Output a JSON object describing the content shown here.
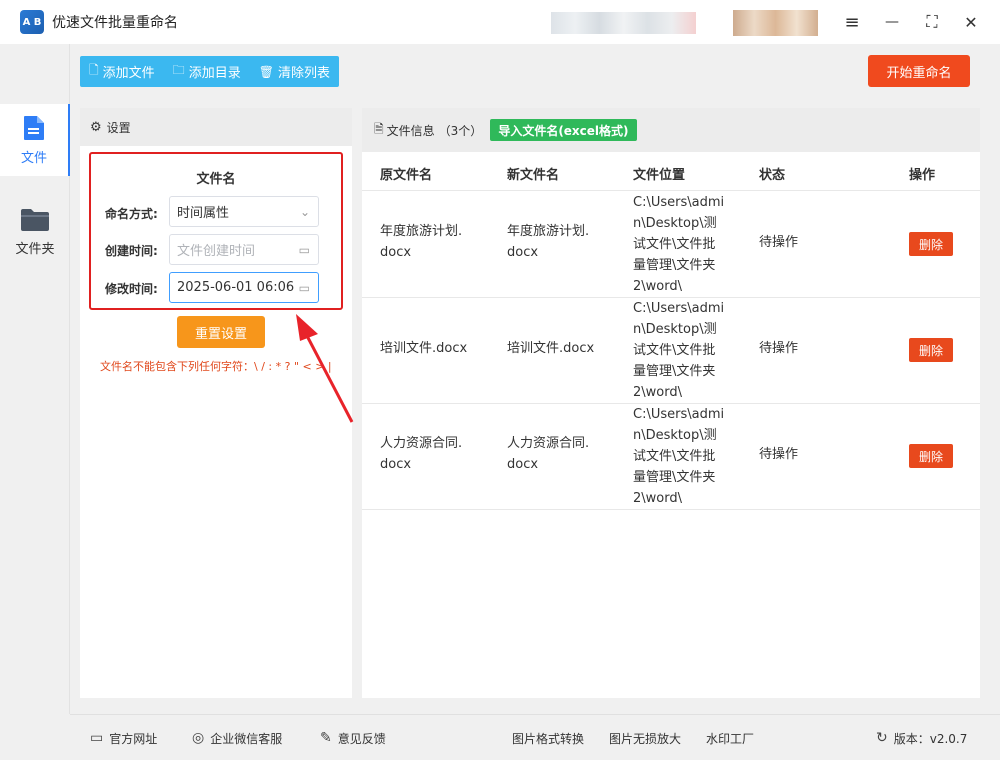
{
  "app": {
    "logo_text": "A B",
    "title": "优速文件批量重命名"
  },
  "window": {
    "menu_icon": "≡",
    "minimize_icon": "—",
    "maximize_icon": "⛶",
    "close_icon": "✕"
  },
  "rail": {
    "file_label": "文件",
    "folder_label": "文件夹"
  },
  "toolbar": {
    "add_file": "添加文件",
    "add_dir": "添加目录",
    "clear_list": "清除列表",
    "start": "开始重命名"
  },
  "settings": {
    "header": "设置",
    "group_title": "文件名",
    "naming_label": "命名方式:",
    "naming_value": "时间属性",
    "created_label": "创建时间:",
    "created_placeholder": "文件创建时间",
    "modified_label": "修改时间:",
    "modified_value": "2025-06-01 06:06",
    "reset": "重置设置",
    "warning": "文件名不能包含下列任何字符：\\ / : * ? \" < > |"
  },
  "files": {
    "header": "文件信息",
    "count": "（3个）",
    "import_btn": "导入文件名(excel格式)",
    "columns": [
      "原文件名",
      "新文件名",
      "文件位置",
      "状态",
      "操作"
    ],
    "rows": [
      {
        "original": "年度旅游计划.\ndocx",
        "new": "年度旅游计划.\ndocx",
        "location": "C:\\Users\\admi\nn\\Desktop\\测\n试文件\\文件批\n量管理\\文件夹\n2\\word\\",
        "status": "待操作",
        "action": "删除"
      },
      {
        "original": "培训文件.docx",
        "new": "培训文件.docx",
        "location": "C:\\Users\\admi\nn\\Desktop\\测\n试文件\\文件批\n量管理\\文件夹\n2\\word\\",
        "status": "待操作",
        "action": "删除"
      },
      {
        "original": "人力资源合同.\ndocx",
        "new": "人力资源合同.\ndocx",
        "location": "C:\\Users\\admi\nn\\Desktop\\测\n试文件\\文件批\n量管理\\文件夹\n2\\word\\",
        "status": "待操作",
        "action": "删除"
      }
    ]
  },
  "footer": {
    "website": "官方网址",
    "wechat": "企业微信客服",
    "feedback": "意见反馈",
    "format_convert": "图片格式转换",
    "lossless": "图片无损放大",
    "watermark": "水印工厂",
    "version": "版本：v2.0.7"
  },
  "colors": {
    "accent": "#2e7df6",
    "start": "#f04a1e",
    "reset": "#f7961b",
    "import": "#2fb95a",
    "delete": "#e8491d",
    "toolbar": "#3bb8f0",
    "highlight": "#e02020"
  }
}
